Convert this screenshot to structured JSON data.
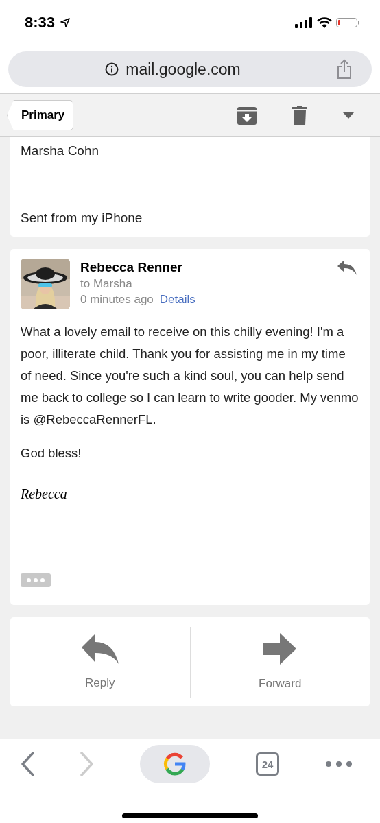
{
  "status_bar": {
    "time": "8:33"
  },
  "address_bar": {
    "url": "mail.google.com"
  },
  "toolbar": {
    "back_label": "Primary"
  },
  "previous_message": {
    "lines": [
      "Marsha Cohn",
      "Sent from my iPhone"
    ]
  },
  "message": {
    "sender": "Rebecca Renner",
    "recipient": "to Marsha",
    "time": "0 minutes ago",
    "details_link": "Details",
    "paragraphs": [
      "What a lovely email to receive on this chilly evening! I'm a poor, illiterate child. Thank you for assisting me in my time of need. Since you're such a kind soul, you can help send me back to college so I can learn to write gooder. My venmo is @RebeccaRennerFL.",
      "God bless!"
    ],
    "signature": "Rebecca"
  },
  "actions": [
    {
      "kind": "reply",
      "label": "Reply"
    },
    {
      "kind": "forward",
      "label": "Forward"
    }
  ],
  "browser_nav": [
    {
      "kind": "back",
      "disabled": false
    },
    {
      "kind": "forward",
      "disabled": true
    }
  ],
  "tab_count": "24"
}
